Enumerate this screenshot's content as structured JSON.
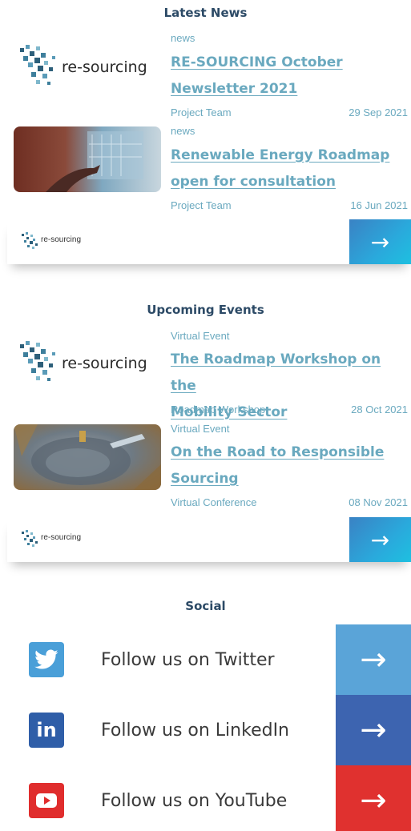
{
  "news": {
    "heading": "Latest News",
    "items": [
      {
        "category": "news",
        "title_line1": "RE-SOURCING October",
        "title_line2": "Newsletter 2021",
        "author": "Project Team",
        "date": "29 Sep 2021",
        "logo_text": "re-sourcing"
      },
      {
        "category": "news",
        "title_line1": "Renewable Energy Roadmap",
        "title_line2": "open for consultation",
        "author": "Project Team",
        "date": "16 Jun 2021"
      }
    ],
    "footer_logo_text": "re-sourcing",
    "more_arrow": "→"
  },
  "events": {
    "heading": "Upcoming Events",
    "items": [
      {
        "category": "Virtual Event",
        "title_line1": "The Roadmap Workshop on the",
        "title_line2": "Mobility Sector",
        "author": "Roadmap Workshop",
        "date": "28 Oct 2021",
        "logo_text": "re-sourcing"
      },
      {
        "category": "Virtual Event",
        "title_line1": "On the Road to Responsible",
        "title_line2": "Sourcing",
        "author": "Virtual Conference",
        "date": "08 Nov 2021"
      }
    ],
    "footer_logo_text": "re-sourcing",
    "more_arrow": "→"
  },
  "social": {
    "heading": "Social",
    "items": [
      {
        "label": "Follow us on Twitter",
        "icon": "twitter-icon",
        "arrow": "→",
        "color": "#5aa4d8",
        "icon_color": "#4a9fd8"
      },
      {
        "label": "Follow us on LinkedIn",
        "icon": "linkedin-icon",
        "arrow": "→",
        "color": "#3d64b0",
        "icon_color": "#2f5ea8",
        "icon_glyph": "in"
      },
      {
        "label": "Follow us on YouTube",
        "icon": "youtube-icon",
        "arrow": "→",
        "color": "#e0312f",
        "icon_color": "#e02d2d"
      }
    ]
  }
}
